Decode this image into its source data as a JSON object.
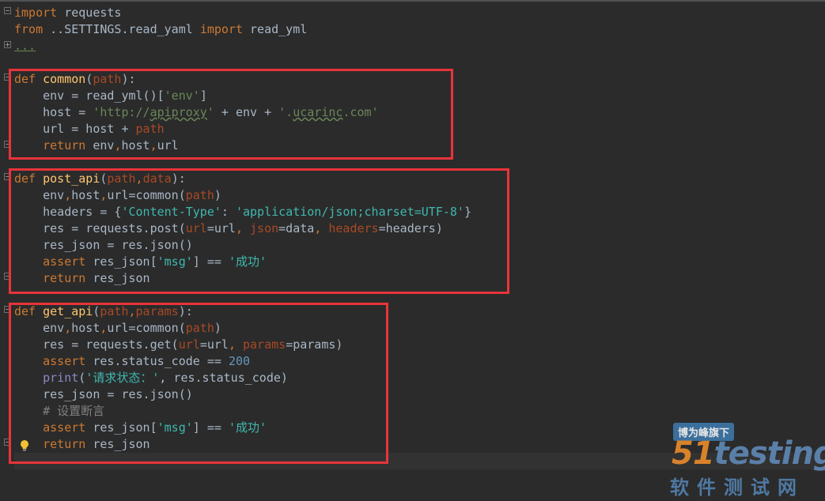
{
  "code": {
    "l1": {
      "kw": "import",
      "rest": " requests"
    },
    "l2": {
      "kw1": "from",
      "mid": " ..SETTINGS.read_yaml ",
      "kw2": "import",
      "rest": " read_yml"
    },
    "l3": {
      "dots": "..."
    },
    "f1": {
      "def": "def",
      "name": "common",
      "sig_open": "(",
      "param": "path",
      "sig_close": "):",
      "b1": {
        "a": "    env = read_yml()[",
        "s": "'env'",
        "b": "]"
      },
      "b2": {
        "a": "    host = ",
        "s1": "'http://",
        "s1u": "apiproxy",
        "s1e": "'",
        "b": " + env + ",
        "s2": "'.",
        "s2u": "ucarinc",
        "s2e": ".com'"
      },
      "b3": {
        "a": "    url = host + ",
        "p": "path"
      },
      "b4": {
        "kw": "return",
        "rest": " env",
        "c1": ",",
        "r2": "host",
        "c2": ",",
        "r3": "url"
      }
    },
    "f2": {
      "def": "def",
      "name": "post_api",
      "sig_open": "(",
      "param1": "path",
      "comma": ",",
      "param2": "data",
      "sig_close": "):",
      "b1": {
        "a": "    env",
        "c1": ",",
        "b": "host",
        "c2": ",",
        "c": "url=common(",
        "p": "path",
        "d": ")"
      },
      "b2": {
        "a": "    headers = {",
        "k": "'Content-Type'",
        "m": ": ",
        "v": "'application/json;charset=UTF-8'",
        "e": "}"
      },
      "b3": {
        "a": "    res = requests.post(",
        "k1": "url",
        "e1": "=url",
        "c1": ", ",
        "k2": "json",
        "e2": "=data",
        "c2": ", ",
        "k3": "headers",
        "e3": "=headers)"
      },
      "b4": {
        "a": "    res_json = res.json()"
      },
      "b5": {
        "kw": "assert",
        "a": " res_json[",
        "s": "'msg'",
        "b": "] == ",
        "s2": "'成功'"
      },
      "b6": {
        "kw": "return",
        "rest": " res_json"
      }
    },
    "f3": {
      "def": "def",
      "name": "get_api",
      "sig_open": "(",
      "param1": "path",
      "comma": ",",
      "param2": "params",
      "sig_close": "):",
      "b1": {
        "a": "    env",
        "c1": ",",
        "b": "host",
        "c2": ",",
        "c": "url=common(",
        "p": "path",
        "d": ")"
      },
      "b2": {
        "a": "    res = requests.get(",
        "k1": "url",
        "e1": "=url",
        "c1": ", ",
        "k2": "params",
        "e2": "=params)"
      },
      "b3": {
        "kw": "assert",
        "a": " res.status_code == ",
        "n": "200"
      },
      "b4": {
        "fn": "print",
        "a": "(",
        "s": "'请求状态：'",
        "b": ", res.status_code)"
      },
      "b5": {
        "a": "    res_json = res.json()"
      },
      "b6": {
        "cmt": "# 设置断言"
      },
      "b7": {
        "kw": "assert",
        "a": " res_json[",
        "s": "'msg'",
        "b": "] == ",
        "s2": "'成功'"
      },
      "b8": {
        "kw": "return",
        "rest": " res_json"
      }
    }
  },
  "watermark": {
    "badge": "博为峰旗下",
    "logo_a": "51",
    "logo_b": "test",
    "logo_c": "ing",
    "sub": "软件测试网"
  },
  "colors": {
    "highlight_box": "#e8343a",
    "background": "#2b2b2b"
  }
}
